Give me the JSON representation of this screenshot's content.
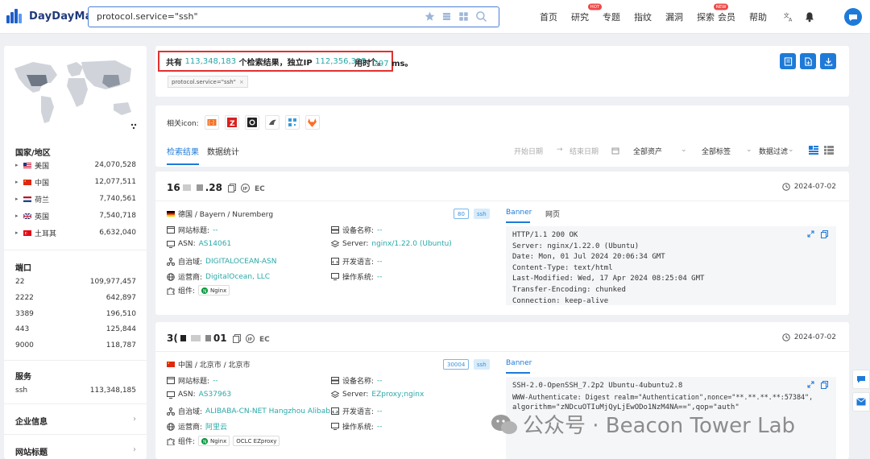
{
  "header": {
    "logo": "DayDayMap",
    "search_value": "protocol.service=\"ssh\"",
    "nav": [
      {
        "label": "首页"
      },
      {
        "label": "研究",
        "badge": "HOT"
      },
      {
        "label": "专题"
      },
      {
        "label": "指纹"
      },
      {
        "label": "漏洞"
      },
      {
        "label": "探索",
        "badge": "NEW"
      },
      {
        "label": "会员"
      },
      {
        "label": "帮助"
      }
    ]
  },
  "sidebar": {
    "country_title": "国家/地区",
    "countries": [
      {
        "name": "美国",
        "count": "24,070,528"
      },
      {
        "name": "中国",
        "count": "12,077,511"
      },
      {
        "name": "荷兰",
        "count": "7,740,561"
      },
      {
        "name": "英国",
        "count": "7,540,718"
      },
      {
        "name": "土耳其",
        "count": "6,632,040"
      }
    ],
    "port_title": "端口",
    "ports": [
      {
        "name": "22",
        "count": "109,977,457"
      },
      {
        "name": "2222",
        "count": "642,897"
      },
      {
        "name": "3389",
        "count": "196,510"
      },
      {
        "name": "443",
        "count": "125,844"
      },
      {
        "name": "9000",
        "count": "118,787"
      }
    ],
    "service_title": "服务",
    "services": [
      {
        "name": "ssh",
        "count": "113,348,185"
      }
    ],
    "enterprise_title": "企业信息",
    "website_title": "网站标题"
  },
  "summary": {
    "prefix": "共有",
    "total": "113,348,183",
    "mid": "个检索结果，独立IP",
    "unique_ip": "112,356,325",
    "suffix": "个。",
    "time_label": "用时",
    "time_value": "297",
    "time_unit": "ms。",
    "query_tag": "protocol.service=\"ssh\""
  },
  "tabs": {
    "related_label": "相关icon:",
    "tab_results": "检索结果",
    "tab_stats": "数据统计",
    "start_date": "开始日期",
    "end_date": "结束日期",
    "all_assets": "全部资产",
    "all_tags": "全部标签",
    "data_filter": "数据过滤"
  },
  "cards": [
    {
      "ip_head": "16",
      "ip_tail": ".28",
      "date": "2024-07-02",
      "location": "德国 / Bayern / Nuremberg",
      "port": "80",
      "protocol": "ssh",
      "labels": {
        "site_title": "网站标题:",
        "asn": "ASN:",
        "as_domain": "自治域:",
        "isp": "运营商:",
        "component": "组件:",
        "device": "设备名称:",
        "server": "Server:",
        "dev_lang": "开发语言:",
        "os": "操作系统:"
      },
      "site_title": "--",
      "asn": "AS14061",
      "as_domain": "DIGITALOCEAN-ASN",
      "isp": "DigitalOcean, LLC",
      "components": [
        "Nginx"
      ],
      "device": "--",
      "server": "nginx/1.22.0 (Ubuntu)",
      "dev_lang": "--",
      "os": "--",
      "banner_tab": "Banner",
      "web_tab": "网页",
      "banner": [
        "HTTP/1.1 200 OK",
        "Server: nginx/1.22.0 (Ubuntu)",
        "Date: Mon, 01 Jul 2024 20:06:34 GMT",
        "Content-Type: text/html",
        "Last-Modified: Wed, 17 Apr 2024 08:25:04 GMT",
        "Transfer-Encoding: chunked",
        "Connection: keep-alive"
      ]
    },
    {
      "ip_head": "3(",
      "ip_tail": "01",
      "date": "2024-07-02",
      "location": "中国 / 北京市 / 北京市",
      "port": "30004",
      "protocol": "ssh",
      "labels": {
        "site_title": "网站标题:",
        "asn": "ASN:",
        "as_domain": "自治域:",
        "isp": "运营商:",
        "component": "组件:",
        "device": "设备名称:",
        "server": "Server:",
        "dev_lang": "开发语言:",
        "os": "操作系统:"
      },
      "site_title": "--",
      "asn": "AS37963",
      "as_domain": "ALIBABA-CN-NET Hangzhou Alibab...",
      "isp": "阿里云",
      "components": [
        "Nginx",
        "OCLC EZproxy"
      ],
      "device": "--",
      "server": "EZproxy;nginx",
      "dev_lang": "--",
      "os": "--",
      "banner_tab": "Banner",
      "banner": [
        "SSH-2.0-OpenSSH_7.2p2 Ubuntu-4ubuntu2.8",
        "WWW-Authenticate: Digest realm=\"Authentication\",nonce=\"**.**.**.**:57384\",",
        "algorithm=\"zNDcuOTIuMjQyLjEwODo1NzM4NA==\",qop=\"auth\""
      ]
    }
  ],
  "watermark": "公众号 · Beacon Tower Lab",
  "colors": {
    "accent": "#1e7ad8",
    "value": "#2aa8a8",
    "highlight_border": "#e23030"
  }
}
